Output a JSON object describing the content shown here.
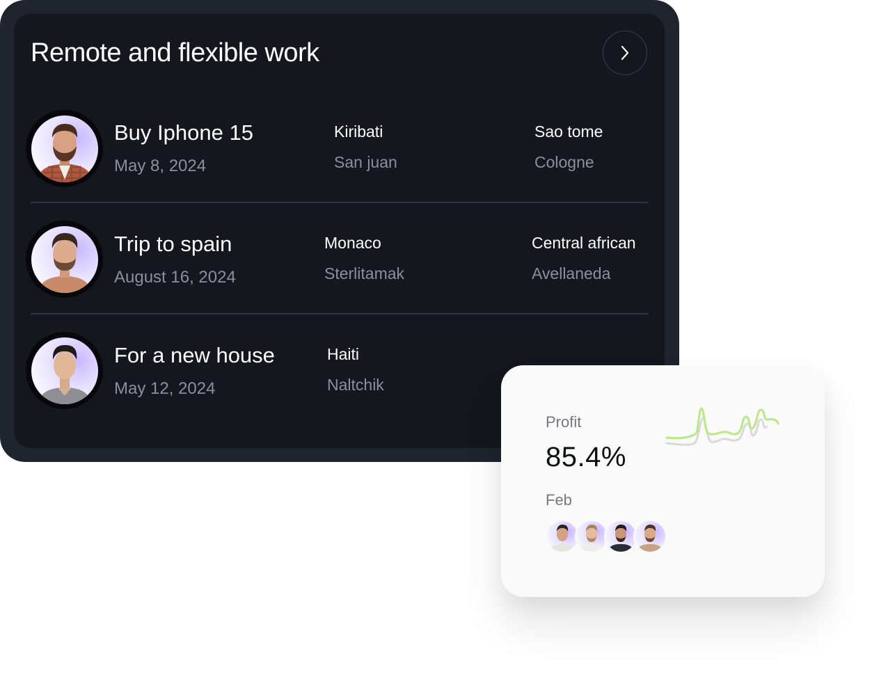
{
  "card": {
    "title": "Remote and flexible work",
    "next_icon": "chevron-right-icon"
  },
  "rows": [
    {
      "title": "Buy Iphone 15",
      "date": "May 8, 2024",
      "col1_top": "Kiribati",
      "col1_bottom": "San juan",
      "col2_top": "Sao tome",
      "col2_bottom": "Cologne"
    },
    {
      "title": "Trip to spain",
      "date": "August 16, 2024",
      "col1_top": "Monaco",
      "col1_bottom": "Sterlitamak",
      "col2_top": "Central african",
      "col2_bottom": "Avellaneda"
    },
    {
      "title": "For a new house",
      "date": "May 12, 2024",
      "col1_top": "Haiti",
      "col1_bottom": "Naltchik"
    }
  ],
  "profit": {
    "label": "Profit",
    "value": "85.4%",
    "month": "Feb",
    "line_color": "#b8e986",
    "shadow_line_color": "#d9d9d9"
  },
  "colors": {
    "dark_outer": "#1f242e",
    "dark_inner": "#14171e",
    "muted_text": "#8c9099",
    "avatar_accent": "#c9b8ff"
  }
}
